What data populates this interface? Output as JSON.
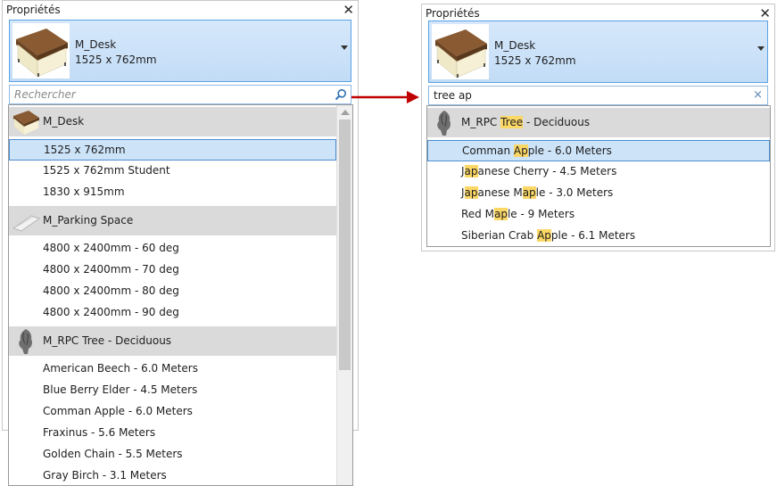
{
  "left": {
    "panel_title": "Propriétés",
    "close_label": "✕",
    "selected_family": "M_Desk",
    "selected_type": "1525 x 762mm",
    "search": {
      "placeholder": "Rechercher",
      "value": ""
    },
    "groups": [
      {
        "name": "M_Desk",
        "thumb": "desk",
        "items": [
          "1525 x 762mm",
          "1525 x 762mm Student",
          "1830 x 915mm"
        ],
        "selected_index": 0
      },
      {
        "name": "M_Parking Space",
        "thumb": "parking",
        "items": [
          "4800 x 2400mm - 60 deg",
          "4800 x 2400mm - 70 deg",
          "4800 x 2400mm - 80 deg",
          "4800 x 2400mm - 90 deg"
        ],
        "selected_index": -1
      },
      {
        "name": "M_RPC Tree - Deciduous",
        "thumb": "tree",
        "items": [
          "American Beech - 6.0 Meters",
          "Blue Berry Elder - 4.5 Meters",
          "Comman Apple - 6.0 Meters",
          "Fraxinus - 5.6 Meters",
          "Golden Chain - 5.5 Meters",
          "Gray Birch - 3.1 Meters"
        ],
        "selected_index": -1
      }
    ]
  },
  "right": {
    "panel_title": "Propriétés",
    "close_label": "✕",
    "selected_family": "M_Desk",
    "selected_type": "1525 x 762mm",
    "search": {
      "value": "tree ap",
      "clear_label": "×"
    },
    "groups": [
      {
        "name_parts": [
          {
            "t": "M_RPC ",
            "h": false
          },
          {
            "t": "Tree",
            "h": true
          },
          {
            "t": " - Deciduous",
            "h": false
          }
        ],
        "thumb": "tree",
        "selected_index": 0,
        "items": [
          [
            {
              "t": "Comman ",
              "h": false
            },
            {
              "t": "Ap",
              "h": true
            },
            {
              "t": "ple - 6.0 Meters",
              "h": false
            }
          ],
          [
            {
              "t": "J",
              "h": false
            },
            {
              "t": "ap",
              "h": true
            },
            {
              "t": "anese Cherry - 4.5 Meters",
              "h": false
            }
          ],
          [
            {
              "t": "J",
              "h": false
            },
            {
              "t": "ap",
              "h": true
            },
            {
              "t": "anese M",
              "h": false
            },
            {
              "t": "ap",
              "h": true
            },
            {
              "t": "le - 3.0 Meters",
              "h": false
            }
          ],
          [
            {
              "t": "Red M",
              "h": false
            },
            {
              "t": "ap",
              "h": true
            },
            {
              "t": "le - 9 Meters",
              "h": false
            }
          ],
          [
            {
              "t": "Siberian Crab ",
              "h": false
            },
            {
              "t": "Ap",
              "h": true
            },
            {
              "t": "ple - 6.1 Meters",
              "h": false
            }
          ]
        ]
      }
    ]
  },
  "colors": {
    "highlight": "#fbd766",
    "selection": "#cce3f8",
    "selection_border": "#4d8ed2",
    "arrow": "#c00000",
    "group_bg": "#dadada"
  },
  "icons": {
    "search": "search-icon",
    "close": "close-icon",
    "dropdown": "chevron-down-icon",
    "clear": "clear-icon",
    "scroll_up": "scroll-up-arrow-icon"
  }
}
